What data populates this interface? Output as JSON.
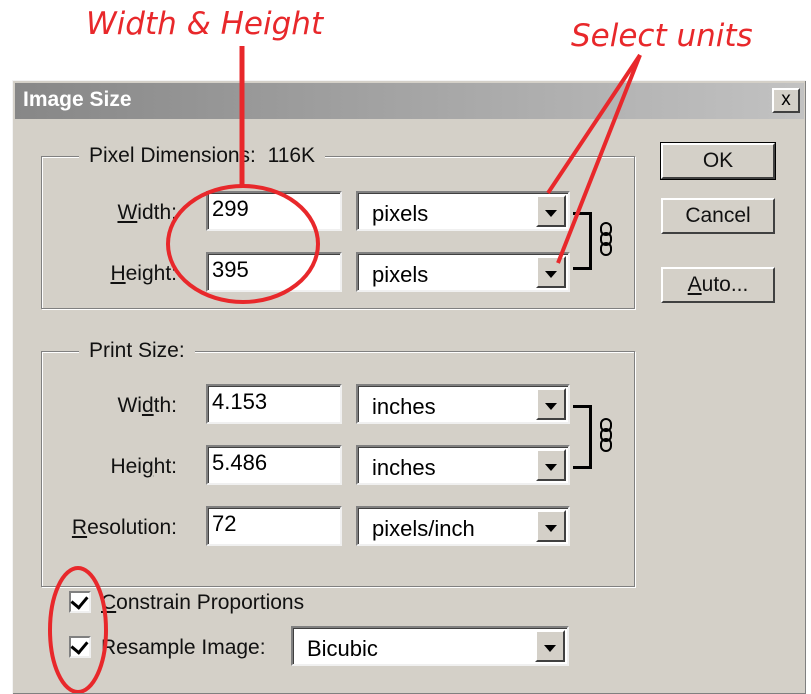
{
  "annotations": {
    "width_height": "Width & Height",
    "select_units": "Select units"
  },
  "dialog": {
    "title": "Image Size",
    "close_label": "x",
    "pixel_dimensions": {
      "legend": "Pixel Dimensions:",
      "size": "116K",
      "width_label": "Width:",
      "width_value": "299",
      "width_unit": "pixels",
      "height_label": "Height:",
      "height_value": "395",
      "height_unit": "pixels"
    },
    "print_size": {
      "legend": "Print Size:",
      "width_label": "Width:",
      "width_value": "4.153",
      "width_unit": "inches",
      "height_label": "Height:",
      "height_value": "5.486",
      "height_unit": "inches",
      "resolution_label": "Resolution:",
      "resolution_value": "72",
      "resolution_unit": "pixels/inch"
    },
    "constrain_proportions": {
      "label": "Constrain Proportions",
      "checked": true
    },
    "resample_image": {
      "label": "Resample Image:",
      "checked": true,
      "method": "Bicubic"
    },
    "buttons": {
      "ok": "OK",
      "cancel": "Cancel",
      "auto": "Auto..."
    }
  },
  "colors": {
    "annotation_red": "#e8282b",
    "dialog_gray": "#d4d0c8",
    "title_gradient_start": "#878787",
    "title_gradient_end": "#c2c2c2"
  }
}
